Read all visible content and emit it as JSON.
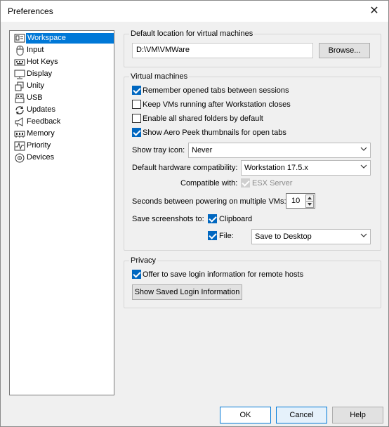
{
  "window": {
    "title": "Preferences",
    "close_glyph": "✕"
  },
  "sidebar": {
    "items": [
      {
        "label": "Workspace",
        "icon": "workspace-icon",
        "selected": true
      },
      {
        "label": "Input",
        "icon": "mouse-icon"
      },
      {
        "label": "Hot Keys",
        "icon": "keyboard-icon"
      },
      {
        "label": "Display",
        "icon": "monitor-icon"
      },
      {
        "label": "Unity",
        "icon": "unity-icon"
      },
      {
        "label": "USB",
        "icon": "usb-icon"
      },
      {
        "label": "Updates",
        "icon": "updates-icon"
      },
      {
        "label": "Feedback",
        "icon": "feedback-icon"
      },
      {
        "label": "Memory",
        "icon": "memory-icon"
      },
      {
        "label": "Priority",
        "icon": "priority-icon"
      },
      {
        "label": "Devices",
        "icon": "devices-icon"
      }
    ]
  },
  "default_location": {
    "title": "Default location for virtual machines",
    "path": "D:\\VM\\VMWare",
    "browse_label": "Browse..."
  },
  "virtual_machines": {
    "title": "Virtual machines",
    "remember_tabs": {
      "label": "Remember opened tabs between sessions",
      "checked": true
    },
    "keep_running": {
      "label": "Keep VMs running after Workstation closes",
      "checked": false
    },
    "enable_shared": {
      "label": "Enable all shared folders by default",
      "checked": false
    },
    "aero_peek": {
      "label": "Show Aero Peek thumbnails for open tabs",
      "checked": true
    },
    "tray_icon": {
      "label": "Show tray icon:",
      "value": "Never"
    },
    "hw_compat": {
      "label": "Default hardware compatibility:",
      "value": "Workstation 17.5.x"
    },
    "compatible_with": {
      "label": "Compatible with:",
      "esx_label": "ESX Server",
      "checked": true
    },
    "power_on": {
      "label": "Seconds between powering on multiple VMs:",
      "value": "10"
    },
    "screenshots": {
      "label": "Save screenshots to:",
      "clipboard_label": "Clipboard",
      "clipboard_checked": true,
      "file_label": "File:",
      "file_checked": true,
      "file_value": "Save to Desktop"
    }
  },
  "privacy": {
    "title": "Privacy",
    "offer_save": {
      "label": "Offer to save login information for remote hosts",
      "checked": true
    },
    "show_saved_label": "Show Saved Login Information"
  },
  "buttons": {
    "ok": "OK",
    "cancel": "Cancel",
    "help": "Help"
  },
  "colors": {
    "accent": "#0078d7",
    "check": "#0067c0"
  }
}
